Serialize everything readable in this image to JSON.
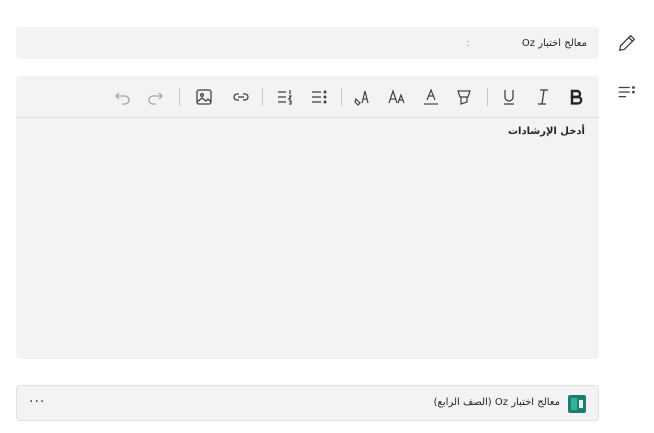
{
  "form": {
    "title_value": "معالج اختبار Oz",
    "title_separator": ":"
  },
  "editor": {
    "placeholder": "أدخل الإرشادات",
    "toolbar": [
      "bold-icon",
      "italic-icon",
      "underline-icon",
      "highlight-icon",
      "font-color-icon",
      "font-size-icon",
      "clear-format-icon",
      "bullet-list-icon",
      "numbered-list-icon",
      "link-icon",
      "image-icon",
      "redo-icon",
      "undo-icon"
    ]
  },
  "card": {
    "title": "معالج اختبار Oz (الصف الرابع)",
    "more": "···",
    "icon": "app-tile-icon"
  },
  "side": {
    "icons": [
      "pencil-icon",
      "instructions-icon"
    ]
  }
}
